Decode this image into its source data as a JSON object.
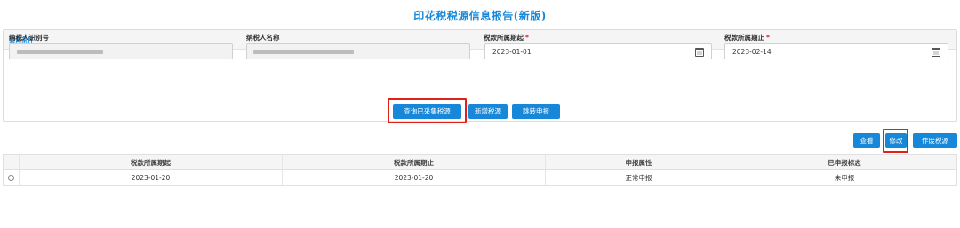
{
  "page": {
    "title": "印花税税源信息报告(新版)"
  },
  "query_panel": {
    "header": "查询条件",
    "fields": {
      "taxpayer_id": {
        "label": "纳税人识别号"
      },
      "taxpayer_name": {
        "label": "纳税人名称"
      },
      "period_start": {
        "label": "税款所属期起",
        "required_mark": "*",
        "value": "2023-01-01"
      },
      "period_end": {
        "label": "税款所属期止",
        "required_mark": "*",
        "value": "2023-02-14"
      }
    },
    "buttons": {
      "query_collected": "查询已采集税源",
      "add_source": "新增税源",
      "jump_declare": "跳转申报"
    }
  },
  "toolbar": {
    "view": "查看",
    "modify": "修改",
    "void_source": "作废税源"
  },
  "table": {
    "columns": [
      "税款所属期起",
      "税款所属期止",
      "申报属性",
      "已申报标志"
    ],
    "rows": [
      [
        "2023-01-20",
        "2023-01-20",
        "正常申报",
        "未申报"
      ]
    ]
  },
  "colors": {
    "accent": "#1687d9",
    "highlight_box": "#e0201a",
    "required": "#e02020"
  }
}
